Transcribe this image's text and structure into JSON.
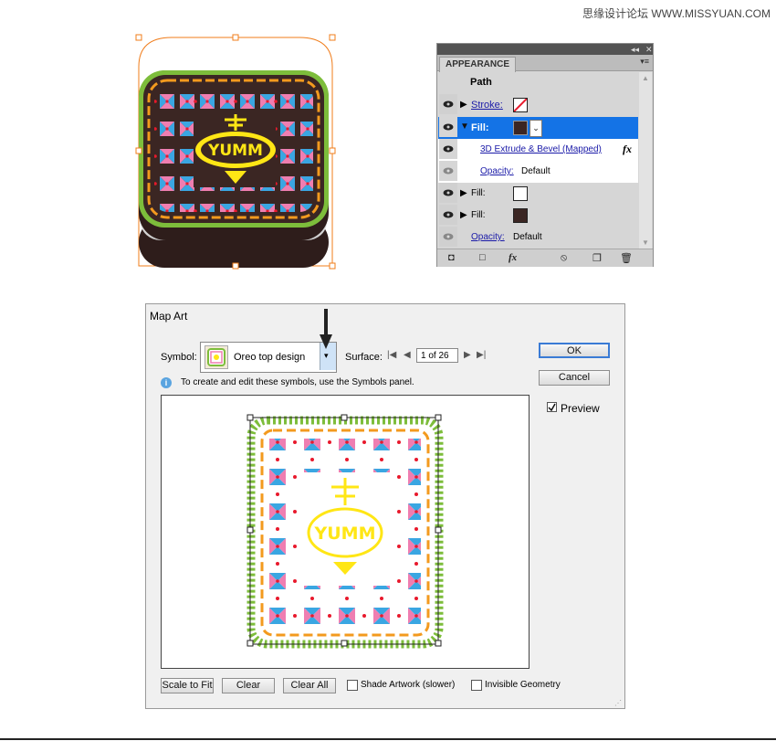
{
  "watermark": "思缘设计论坛 WWW.MISSYUAN.COM",
  "appearance": {
    "tab": "APPEARANCE",
    "path_label": "Path",
    "rows": [
      {
        "label": "Stroke:",
        "link": true,
        "swatch": "none"
      },
      {
        "label": "Fill:",
        "link": false,
        "swatch": "#3b2623",
        "selected": true
      },
      {
        "label": "3D Extrude & Bevel (Mapped)",
        "link": true,
        "fx": "fx"
      },
      {
        "label": "Opacity:",
        "value": "Default"
      },
      {
        "label": "Fill:",
        "swatch": "#ffffff"
      },
      {
        "label": "Fill:",
        "swatch": "#3b2623"
      },
      {
        "label": "Opacity:",
        "value": "Default"
      }
    ],
    "footer_fx": "fx"
  },
  "map_art": {
    "title": "Map Art",
    "symbol_label": "Symbol:",
    "symbol_value": "Oreo top design",
    "surface_label": "Surface:",
    "surface_value": "1 of 26",
    "info_text": "To create and edit these symbols, use the Symbols panel.",
    "ok": "OK",
    "cancel": "Cancel",
    "preview": "Preview",
    "scale_to_fit": "Scale to Fit",
    "clear": "Clear",
    "clear_all": "Clear All",
    "shade_artwork": "Shade Artwork (slower)",
    "invisible_geometry": "Invisible Geometry",
    "artwork_text": "YUMM"
  },
  "icon_artwork_text": "YUMM",
  "colors": {
    "selected_row": "#1473e6",
    "chocolate": "#3b2623",
    "green": "#7dbd3b",
    "orange": "#f39a1e",
    "pink": "#ef7eb1",
    "blue": "#3aa6e2",
    "red": "#e8192c",
    "yellow": "#ffe615"
  }
}
